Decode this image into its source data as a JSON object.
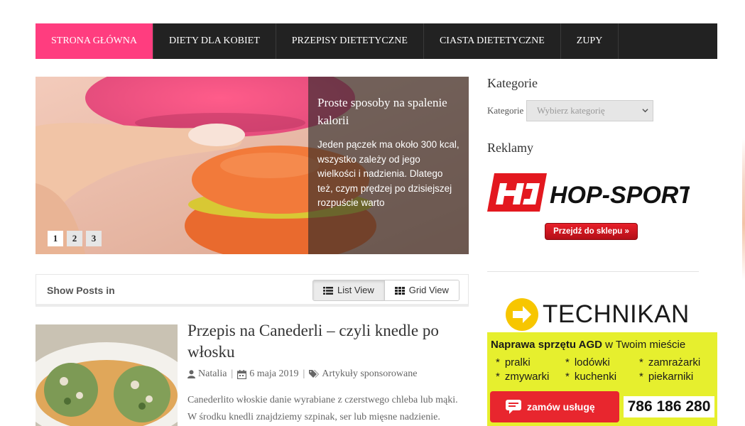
{
  "nav": {
    "items": [
      "STRONA GŁÓWNA",
      "DIETY DLA KOBIET",
      "PRZEPISY DIETETYCZNE",
      "CIASTA DIETETYCZNE",
      "ZUPY"
    ],
    "active_color": "#ff3d7f",
    "bg_color": "#222222"
  },
  "slider": {
    "title": "Proste sposoby na spalenie kalorii",
    "text": "Jeden pączek ma około 300 kcal, wszystko zależy od jego wielkości i nadzienia. Dlatego też, czym prędzej po dzisiejszej rozpuście warto",
    "pages": [
      "1",
      "2",
      "3"
    ],
    "active_page": "1"
  },
  "viewbar": {
    "label": "Show Posts in",
    "list_label": "List View",
    "grid_label": "Grid View",
    "active": "list"
  },
  "post": {
    "title": "Przepis na Canederli – czyli knedle po włosku",
    "author": "Natalia",
    "date": "6 maja 2019",
    "category": "Artykuły sponsorowane",
    "excerpt": "Canederlito włoskie danie wyrabiane z czerstwego chleba lub mąki. W środku knedli znajdziemy szpinak, ser lub mięsne nadzienie."
  },
  "sidebar": {
    "categories_title": "Kategorie",
    "categories_label": "Kategorie",
    "categories_placeholder": "Wybierz kategorię",
    "ads_title": "Reklamy",
    "hop_brand": "HOP-SPORT",
    "hop_button": "Przejdź do sklepu »",
    "tech": {
      "brand": "TECHNIKAN",
      "tagline_bold": "Naprawa sprzętu AGD",
      "tagline_rest": " w Twoim mieście",
      "items": [
        "pralki",
        "lodówki",
        "zamrażarki",
        "zmywarki",
        "kuchenki",
        "piekarniki"
      ],
      "order_label": "zamów usługę",
      "phone": "786 186 280"
    }
  }
}
